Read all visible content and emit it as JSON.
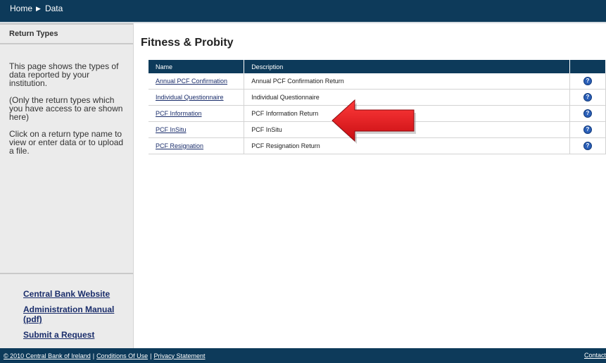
{
  "breadcrumb": {
    "home": "Home",
    "data": "Data"
  },
  "sidebar": {
    "title": "Return Types",
    "paragraphs": [
      "This page shows the types of data reported by your institution.",
      "(Only the return types which you have access to are shown here)",
      "Click on a return type name to view or enter data or to upload a file."
    ],
    "links": [
      "Central Bank Website",
      "Administration Manual (pdf)",
      "Submit a Request"
    ]
  },
  "main": {
    "title": "Fitness & Probity",
    "table": {
      "headers": [
        "Name",
        "Description",
        ""
      ],
      "rows": [
        {
          "name": "Annual PCF Confirmation",
          "description": "Annual PCF Confirmation Return"
        },
        {
          "name": "Individual Questionnaire",
          "description": "Individual Questionnaire"
        },
        {
          "name": "PCF Information",
          "description": "PCF Information Return"
        },
        {
          "name": "PCF InSitu",
          "description": "PCF InSitu"
        },
        {
          "name": "PCF Resignation",
          "description": "PCF Resignation Return"
        }
      ],
      "help_symbol": "?"
    }
  },
  "footer": {
    "copyright": "© 2010 Central Bank of Ireland",
    "conditions": "Conditions Of Use",
    "privacy": "Privacy Statement",
    "separator": "|",
    "contact": "Contact"
  },
  "colors": {
    "navy": "#0d3a5a",
    "link": "#1a2d6b",
    "arrow": "#e8141b",
    "help": "#2a5fb8"
  },
  "icons": {
    "breadcrumb_separator": "triangle-right-icon",
    "help": "help-icon",
    "pointer": "red-arrow-icon"
  }
}
